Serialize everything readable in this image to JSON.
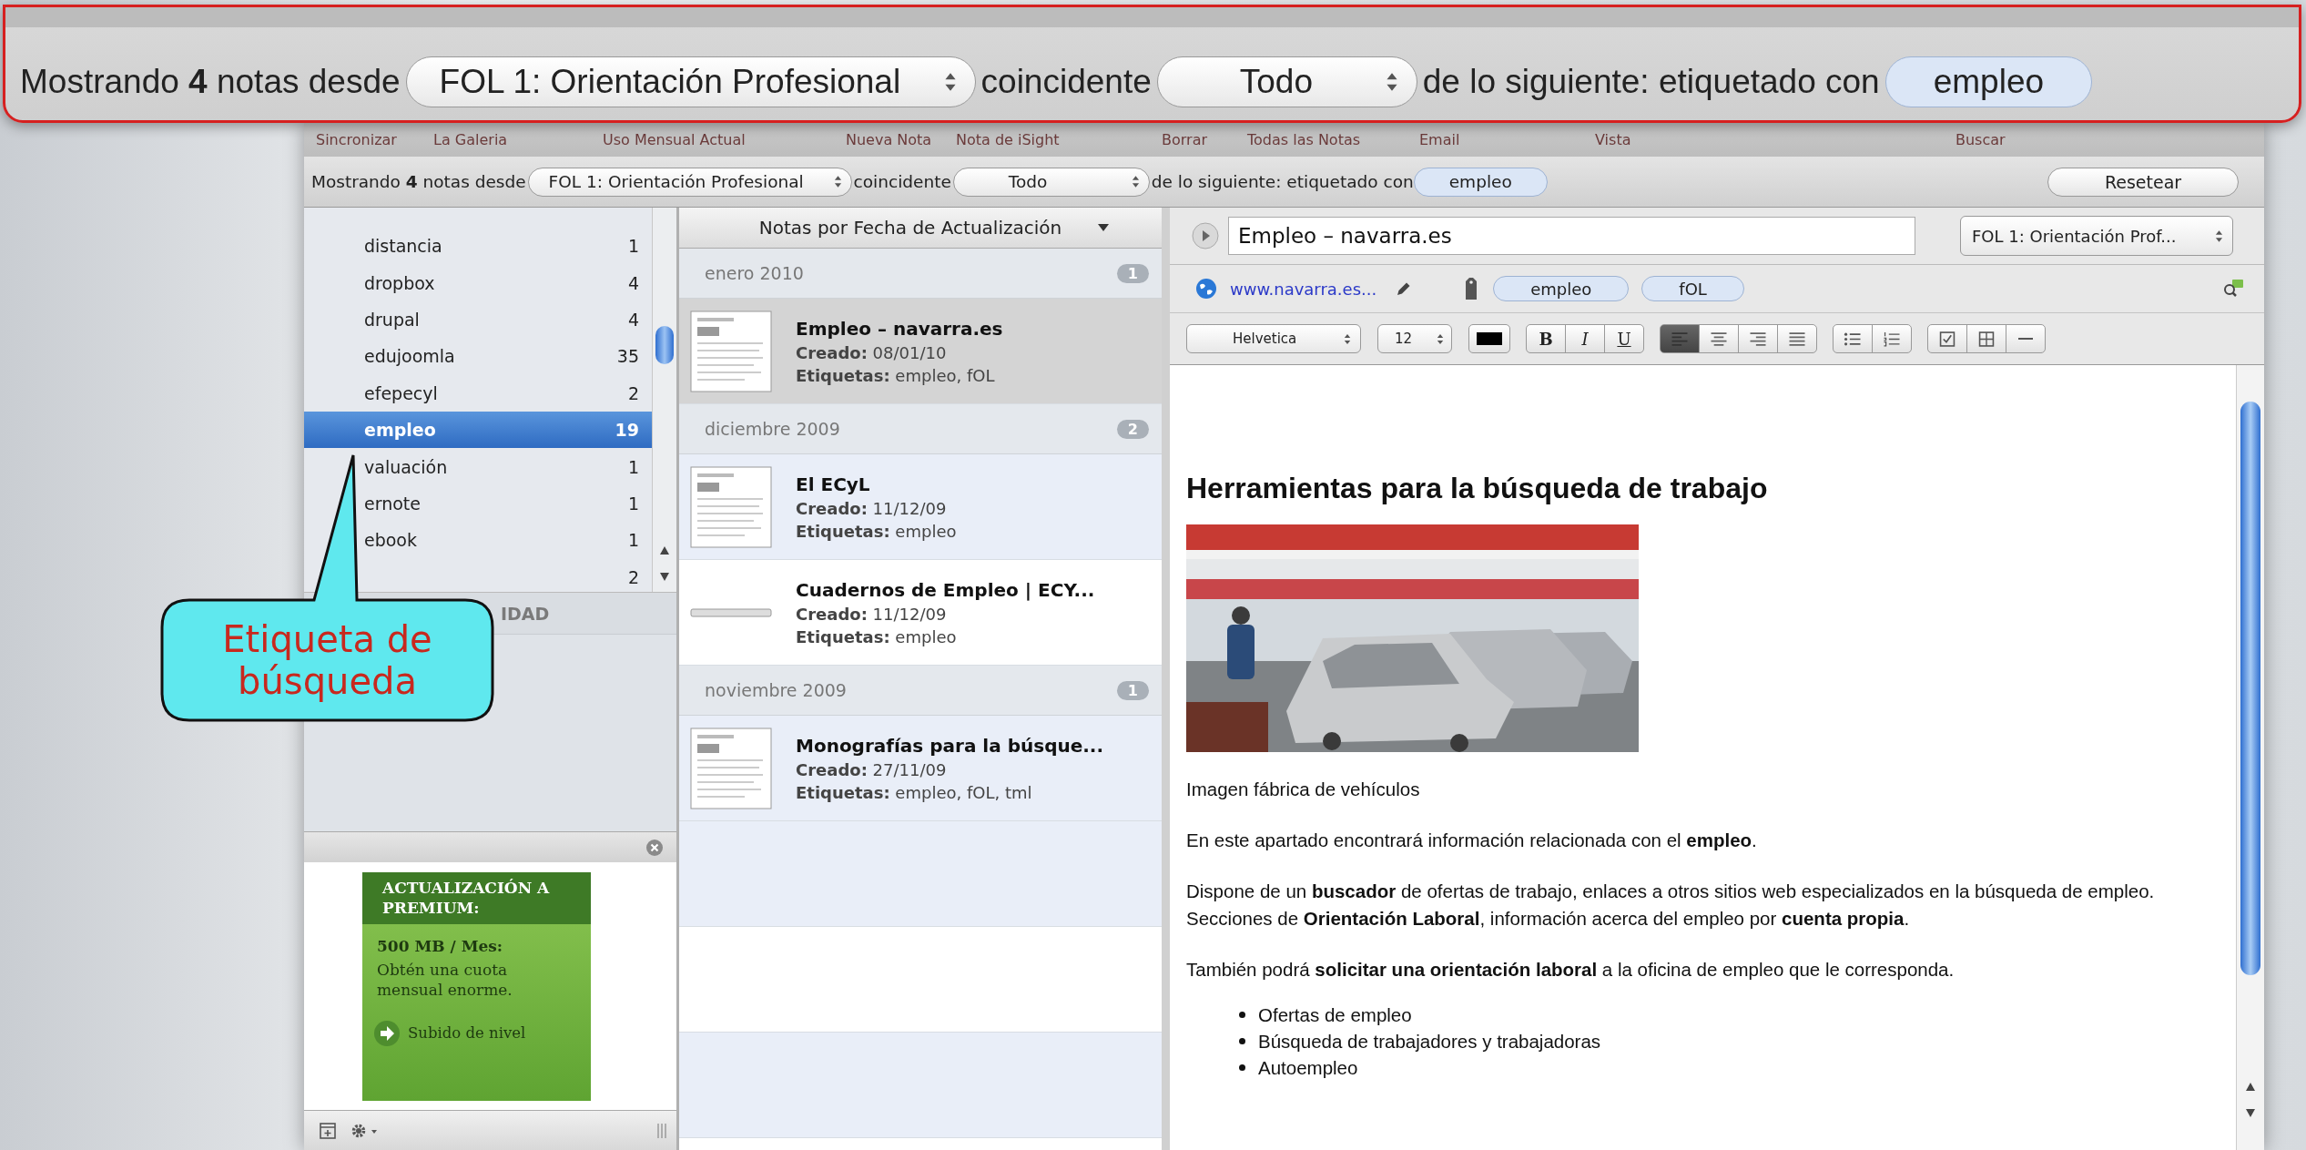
{
  "magnifier": {
    "filter": {
      "prefix": "Mostrando **4** notas desde",
      "notebook": "FOL 1: Orientación Profesional",
      "match_label": "coincidente",
      "match": "Todo",
      "suffix": "de lo siguiente: etiquetado con",
      "tag": "empleo"
    }
  },
  "toolbar": [
    "Sincronizar",
    "La Galeria",
    "Uso Mensual Actual",
    "Nueva Nota",
    "Nota de iSight",
    "Borrar",
    "Todas las Notas",
    "Email",
    "Vista",
    "Buscar"
  ],
  "filter": {
    "prefix": "Mostrando **4** notas desde",
    "notebook": "FOL 1: Orientación Profesional",
    "match_label": "coincidente",
    "match": "Todo",
    "suffix": "de lo siguiente: etiquetado con",
    "tag": "empleo",
    "reset": "Resetear"
  },
  "sidebar": {
    "tags": [
      {
        "name": "distancia",
        "count": "1",
        "selected": false
      },
      {
        "name": "dropbox",
        "count": "4",
        "selected": false
      },
      {
        "name": "drupal",
        "count": "4",
        "selected": false
      },
      {
        "name": "edujoomla",
        "count": "35",
        "selected": false
      },
      {
        "name": "efepecyl",
        "count": "2",
        "selected": false
      },
      {
        "name": "empleo",
        "count": "19",
        "selected": true
      },
      {
        "name": "valuación",
        "count": "1",
        "selected": false
      },
      {
        "name": "ernote",
        "count": "1",
        "selected": false
      },
      {
        "name": "ebook",
        "count": "1",
        "selected": false
      },
      {
        "count": "2",
        "selected": false
      }
    ],
    "section": "IDAD",
    "ad": {
      "heading": "ACTUALIZACIÓN A PREMIUM:",
      "offer": "500 MB / Mes:",
      "text": "Obtén una cuota mensual enorme.",
      "action": "Subido de nivel"
    }
  },
  "notes": {
    "sort": "Notas por Fecha de Actualización",
    "groups": [
      {
        "label": "enero 2010",
        "count": "1",
        "notes": [
          {
            "title": "Empleo – navarra.es",
            "created": "**Creado:** 08/01/10",
            "tags": "**Etiquetas:** empleo, fOL",
            "kind": "page",
            "selected": true
          }
        ]
      },
      {
        "label": "diciembre 2009",
        "count": "2",
        "notes": [
          {
            "title": "El ECyL",
            "created": "**Creado:** 11/12/09",
            "tags": "**Etiquetas:** empleo",
            "kind": "page",
            "selected": false
          },
          {
            "title": "Cuadernos de Empleo | ECY...",
            "created": "**Creado:** 11/12/09",
            "tags": "**Etiquetas:** empleo",
            "kind": "bar",
            "selected": false
          }
        ]
      },
      {
        "label": "noviembre 2009",
        "count": "1",
        "notes": [
          {
            "title": "Monografías para la búsque...",
            "created": "**Creado:** 27/11/09",
            "tags": "**Etiquetas:** empleo, fOL, tml",
            "kind": "page",
            "selected": false
          }
        ]
      }
    ]
  },
  "editor": {
    "title": "Empleo – navarra.es",
    "notebook": "FOL 1: Orientación Prof...",
    "url": "www.navarra.es...",
    "tags": [
      "empleo",
      "fOL"
    ],
    "font": "Helvetica",
    "size": "12",
    "styles": [
      "B",
      "I",
      "U"
    ],
    "align": [
      {
        "selected": true
      },
      {
        "selected": false
      },
      {
        "selected": false
      },
      {
        "selected": false
      }
    ],
    "heading": "Herramientas para la búsqueda de trabajo",
    "caption": "Imagen fábrica de vehículos",
    "paragraphs": [
      "En este apartado encontrará información relacionada con el **empleo**.",
      "Dispone de un **buscador** de ofertas de trabajo, enlaces a otros sitios web especializados en la búsqueda de empleo. Secciones de **Orientación Laboral**, información acerca del empleo por **cuenta propia**.",
      "También podrá **solicitar una orientación laboral** a la oficina de empleo que le corresponda."
    ],
    "bullets": [
      "Ofertas de empleo",
      "Búsqueda de trabajadores y trabajadoras",
      "Autoempleo"
    ]
  },
  "callout": {
    "text": "Etiqueta de búsqueda"
  }
}
